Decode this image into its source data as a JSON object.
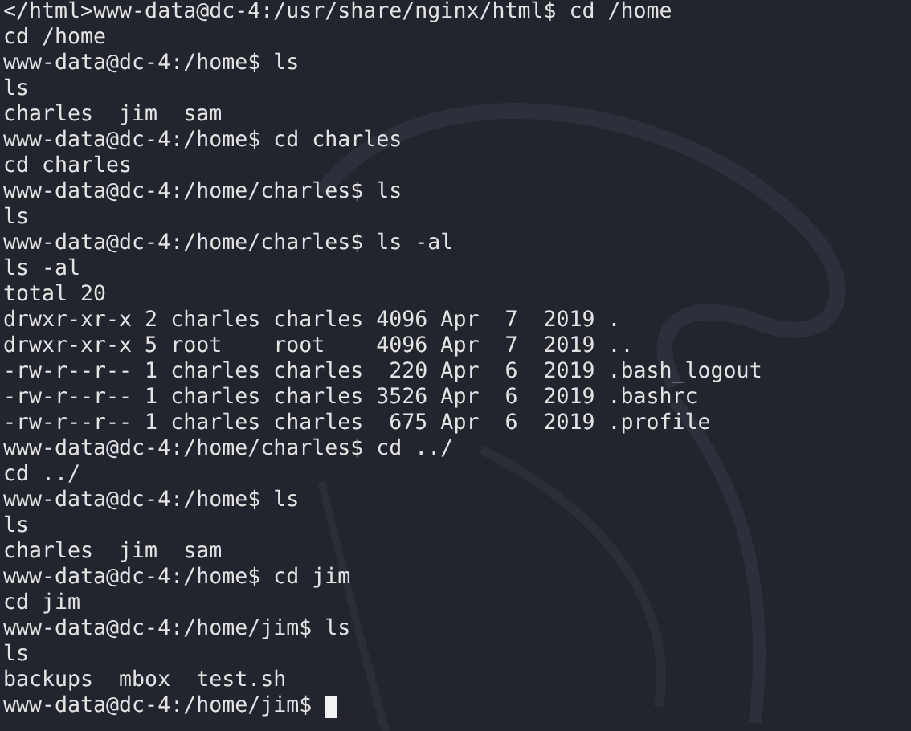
{
  "terminal": {
    "lines": [
      {
        "text": "</html>www-data@dc-4:/usr/share/nginx/html$ cd /home",
        "cursor": false
      },
      {
        "text": "cd /home",
        "cursor": false
      },
      {
        "text": "www-data@dc-4:/home$ ls",
        "cursor": false
      },
      {
        "text": "ls",
        "cursor": false
      },
      {
        "text": "charles  jim  sam",
        "cursor": false
      },
      {
        "text": "www-data@dc-4:/home$ cd charles",
        "cursor": false
      },
      {
        "text": "cd charles",
        "cursor": false
      },
      {
        "text": "www-data@dc-4:/home/charles$ ls",
        "cursor": false
      },
      {
        "text": "ls",
        "cursor": false
      },
      {
        "text": "www-data@dc-4:/home/charles$ ls -al",
        "cursor": false
      },
      {
        "text": "ls -al",
        "cursor": false
      },
      {
        "text": "total 20",
        "cursor": false
      },
      {
        "text": "drwxr-xr-x 2 charles charles 4096 Apr  7  2019 .",
        "cursor": false
      },
      {
        "text": "drwxr-xr-x 5 root    root    4096 Apr  7  2019 ..",
        "cursor": false
      },
      {
        "text": "-rw-r--r-- 1 charles charles  220 Apr  6  2019 .bash_logout",
        "cursor": false
      },
      {
        "text": "-rw-r--r-- 1 charles charles 3526 Apr  6  2019 .bashrc",
        "cursor": false
      },
      {
        "text": "-rw-r--r-- 1 charles charles  675 Apr  6  2019 .profile",
        "cursor": false
      },
      {
        "text": "www-data@dc-4:/home/charles$ cd ../",
        "cursor": false
      },
      {
        "text": "cd ../",
        "cursor": false
      },
      {
        "text": "www-data@dc-4:/home$ ls",
        "cursor": false
      },
      {
        "text": "ls",
        "cursor": false
      },
      {
        "text": "charles  jim  sam",
        "cursor": false
      },
      {
        "text": "www-data@dc-4:/home$ cd jim",
        "cursor": false
      },
      {
        "text": "cd jim",
        "cursor": false
      },
      {
        "text": "www-data@dc-4:/home/jim$ ls",
        "cursor": false
      },
      {
        "text": "ls",
        "cursor": false
      },
      {
        "text": "backups  mbox  test.sh",
        "cursor": false
      },
      {
        "text": "www-data@dc-4:/home/jim$",
        "cursor": true
      }
    ]
  }
}
